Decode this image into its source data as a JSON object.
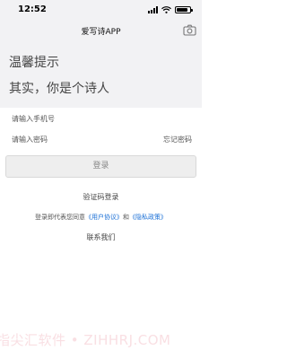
{
  "status_bar": {
    "time": "12:52",
    "icons": [
      "signal-icon",
      "wifi-icon",
      "battery-icon"
    ]
  },
  "nav": {
    "title": "爱写诗APP",
    "right_icon": "camera-icon"
  },
  "hero": {
    "title": "温馨提示",
    "subtitle": "其实，你是个诗人"
  },
  "form": {
    "phone_placeholder": "请输入手机号",
    "password_placeholder": "请输入密码",
    "forgot_label": "忘记密码",
    "login_label": "登录"
  },
  "links": {
    "code_login": "验证码登录",
    "agreement_prefix": "登录即代表您同意",
    "user_agreement": "《用户协议》",
    "agreement_and": "和",
    "privacy_policy": "《隐私政策》",
    "contact": "联系我们"
  },
  "watermark": "指尖汇软件 • ZIHHRJ.COM",
  "colors": {
    "header_bg": "#f2f2f4",
    "link": "#1a6fd6",
    "button_bg": "#eeeeee",
    "watermark": "#f9dfe3"
  }
}
